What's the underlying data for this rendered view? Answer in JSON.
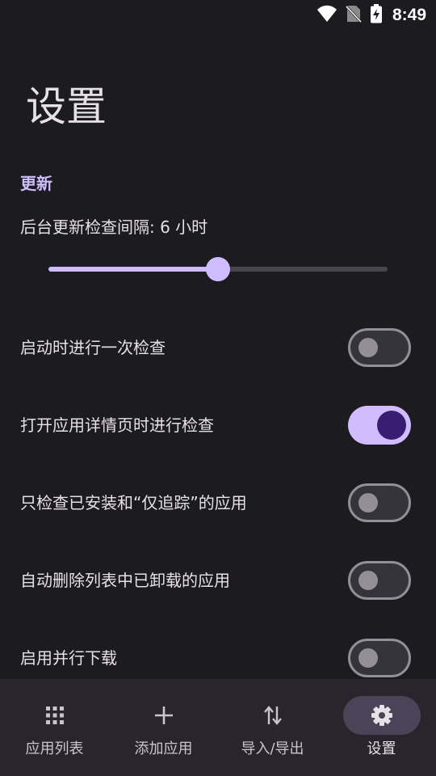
{
  "status_bar": {
    "time": "8:49",
    "icons": [
      "wifi-icon",
      "no-sim-icon",
      "battery-charging-icon"
    ]
  },
  "page": {
    "title": "设置"
  },
  "section": {
    "title": "更新"
  },
  "interval": {
    "label": "后台更新检查间隔: 6 小时",
    "slider_value_fraction": 0.5
  },
  "settings": [
    {
      "label": "启动时进行一次检查",
      "enabled": false
    },
    {
      "label": "打开应用详情页时进行检查",
      "enabled": true
    },
    {
      "label": "只检查已安装和“仅追踪”的应用",
      "enabled": false
    },
    {
      "label": "自动删除列表中已卸载的应用",
      "enabled": false
    },
    {
      "label": "启用并行下载",
      "enabled": false
    }
  ],
  "bottom_nav": {
    "items": [
      {
        "label": "应用列表",
        "icon": "grid-icon",
        "active": false
      },
      {
        "label": "添加应用",
        "icon": "add-icon",
        "active": false
      },
      {
        "label": "导入/导出",
        "icon": "import-export-icon",
        "active": false
      },
      {
        "label": "设置",
        "icon": "settings-gear-icon",
        "active": true
      }
    ]
  },
  "colors": {
    "background": "#1c1b1f",
    "accent": "#d0bcff",
    "accent_dark": "#381e72",
    "nav_background": "#28262c",
    "nav_indicator": "#4a4458"
  }
}
